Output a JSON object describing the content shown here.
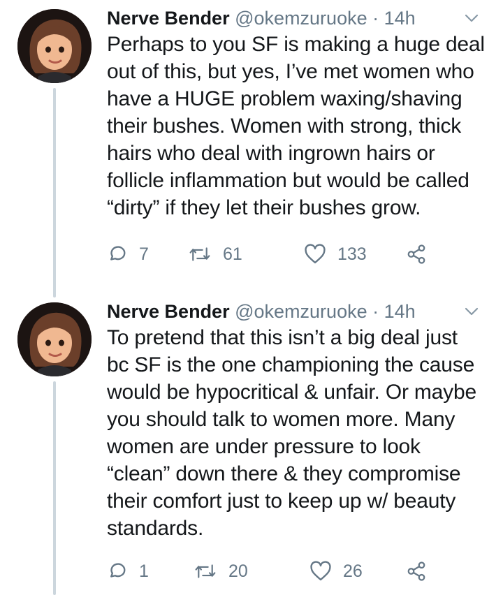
{
  "tweets": [
    {
      "name": "Nerve Bender",
      "handle": "@okemzuruoke",
      "separator": "·",
      "time": "14h",
      "text": "Perhaps to you SF is making a huge deal\nout of this, but yes, I’ve met women who\nhave a HUGE problem waxing/shaving\ntheir bushes. Women with strong, thick\nhairs who deal with ingrown hairs or\nfollicle inflammation but would be called\n“dirty” if they let their bushes grow.",
      "replies": "7",
      "retweets": "61",
      "likes": "133"
    },
    {
      "name": "Nerve Bender",
      "handle": "@okemzuruoke",
      "separator": "·",
      "time": "14h",
      "text": "To pretend that this isn’t a big deal just\nbc SF is the one championing the cause\nwould be hypocritical & unfair. Or maybe\nyou should talk to women more. Many\nwomen are under pressure to look\n“clean” down there & they compromise\ntheir comfort just to keep up w/ beauty\nstandards.",
      "replies": "1",
      "retweets": "20",
      "likes": "26"
    }
  ],
  "icons": {
    "avatar": "avatar-memoji",
    "menu": "chevron-down-icon",
    "reply": "reply-icon",
    "retweet": "retweet-icon",
    "like": "heart-icon",
    "share": "share-icon"
  },
  "colors": {
    "text": "#14171a",
    "secondary": "#657786",
    "thread_line": "#ccd6dd"
  }
}
